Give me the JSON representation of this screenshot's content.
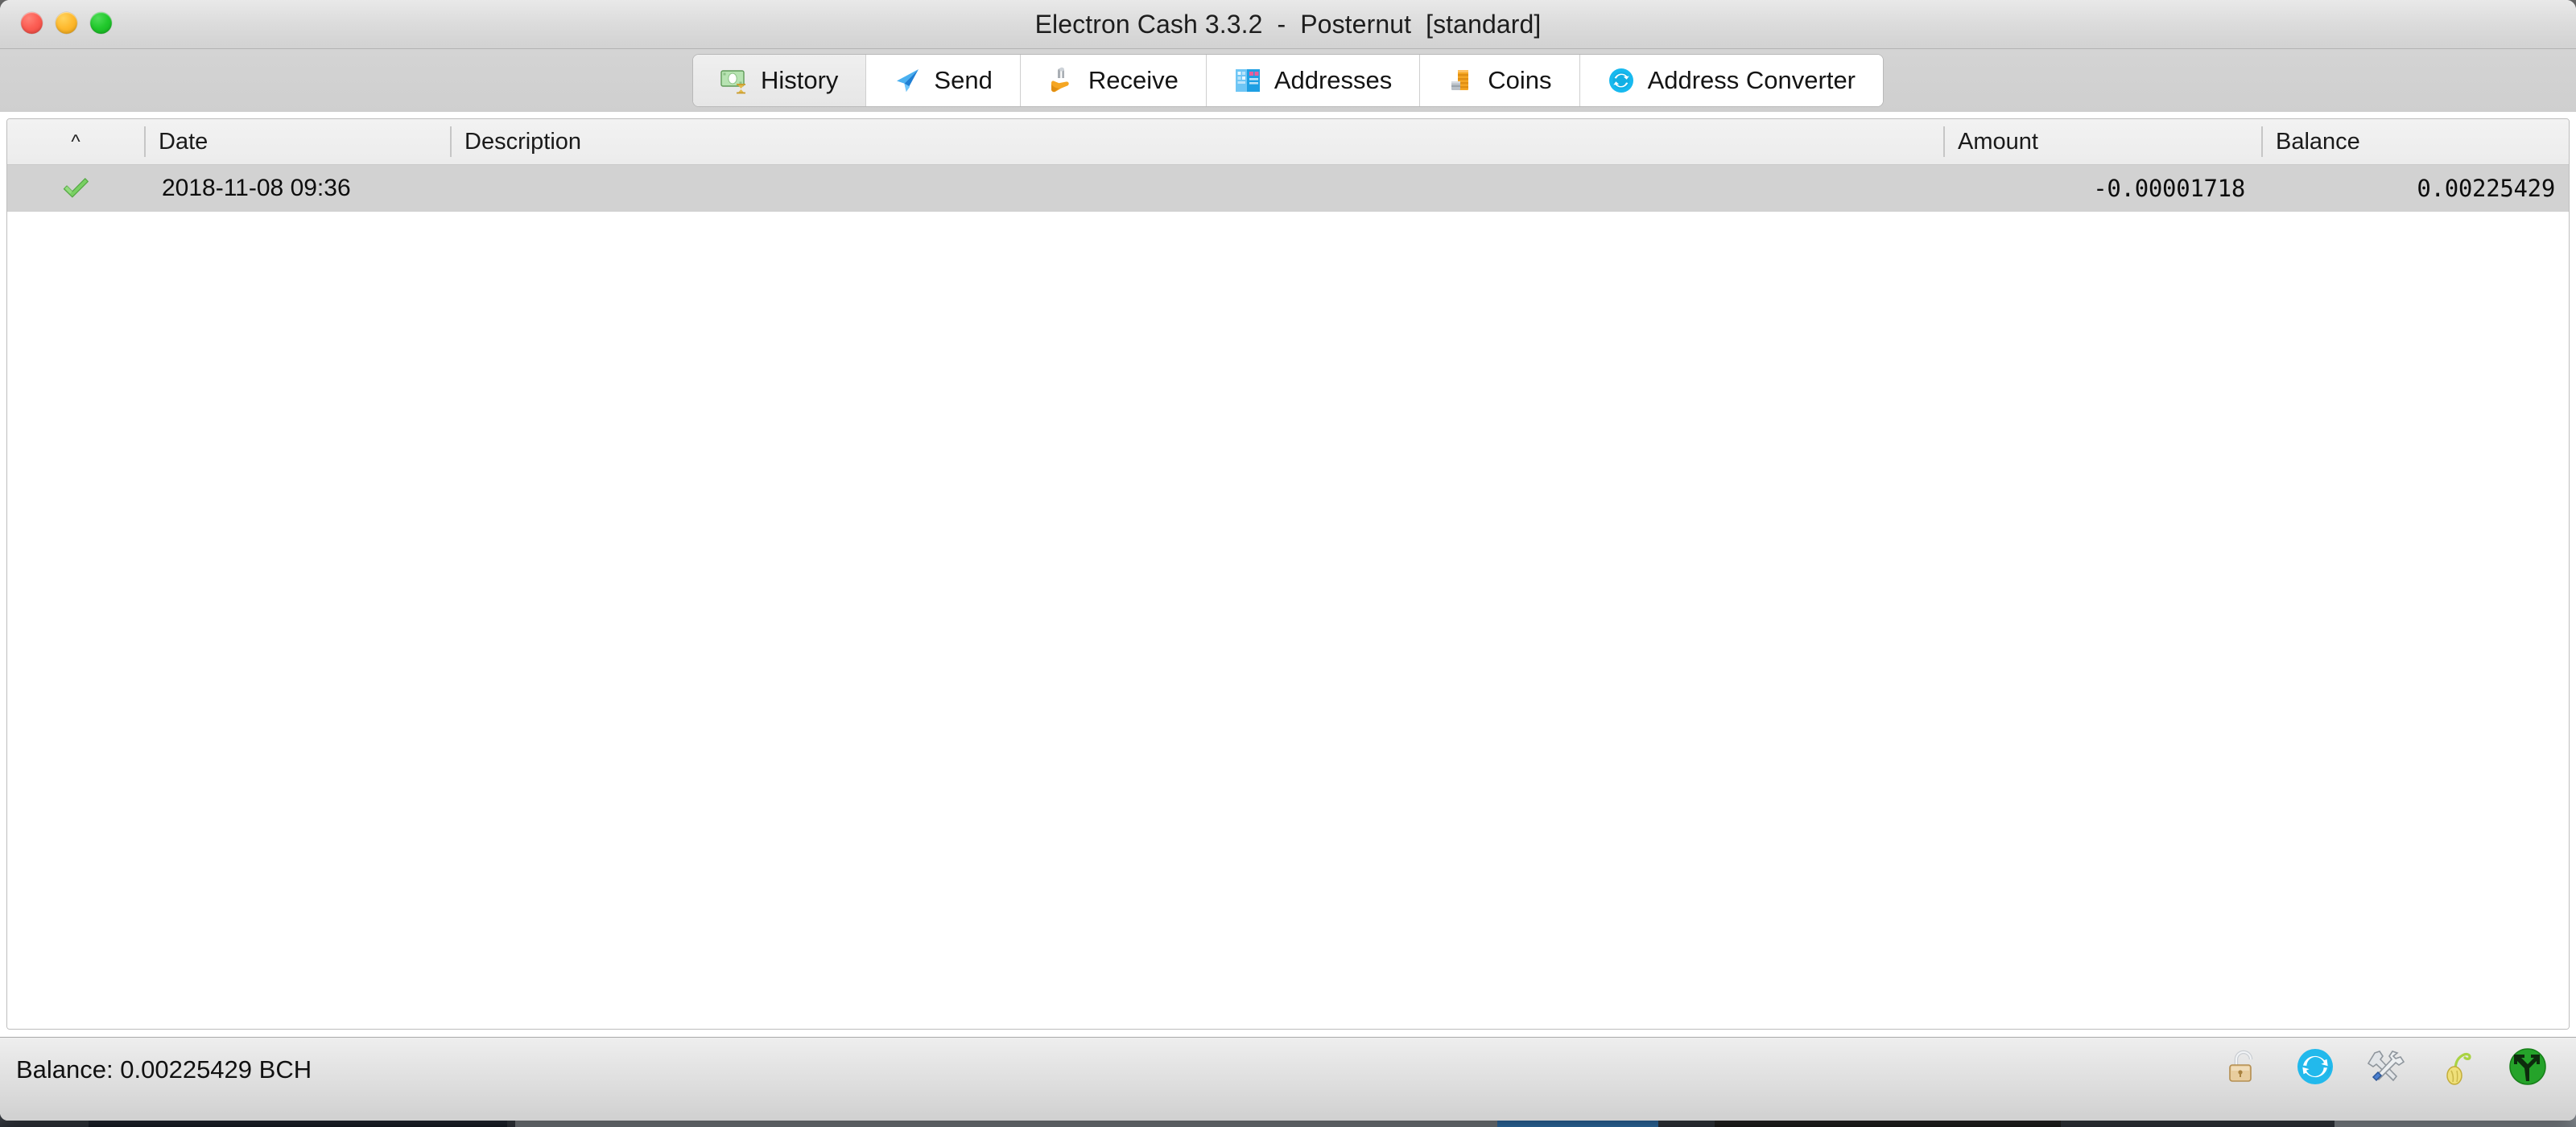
{
  "window": {
    "title": "Electron Cash 3.3.2  -  Posternut  [standard]",
    "controls": [
      {
        "name": "close",
        "color": "#fc5d53"
      },
      {
        "name": "minimize",
        "color": "#feb92e"
      },
      {
        "name": "maximize",
        "color": "#21c92c"
      }
    ]
  },
  "tabs": [
    {
      "id": "history",
      "label": "History",
      "icon": "banknote-hourglass-icon",
      "active": true
    },
    {
      "id": "send",
      "label": "Send",
      "icon": "paper-plane-icon",
      "active": false
    },
    {
      "id": "receive",
      "label": "Receive",
      "icon": "hand-coin-icon",
      "active": false
    },
    {
      "id": "addresses",
      "label": "Addresses",
      "icon": "address-book-icon",
      "active": false
    },
    {
      "id": "coins",
      "label": "Coins",
      "icon": "coin-stack-icon",
      "active": false
    },
    {
      "id": "address_converter",
      "label": "Address Converter",
      "icon": "convert-circle-icon",
      "active": false
    }
  ],
  "history_table": {
    "sort_indicator": "^",
    "columns": [
      {
        "id": "status",
        "label": ""
      },
      {
        "id": "date",
        "label": "Date"
      },
      {
        "id": "description",
        "label": "Description"
      },
      {
        "id": "amount",
        "label": "Amount"
      },
      {
        "id": "balance",
        "label": "Balance"
      }
    ],
    "rows": [
      {
        "status_icon": "confirmed-check-icon",
        "date": "2018-11-08 09:36",
        "description": "",
        "amount": "-0.00001718",
        "balance": "0.00225429",
        "selected": true
      }
    ]
  },
  "statusbar": {
    "balance_label": "Balance: 0.00225429 BCH",
    "icons": [
      {
        "id": "lock",
        "name": "padlock-open-icon",
        "color": "#d8b97e"
      },
      {
        "id": "sync",
        "name": "sync-circle-icon",
        "color": "#22b9ec"
      },
      {
        "id": "tools",
        "name": "tools-icon",
        "color": "#c9c9c9"
      },
      {
        "id": "seed",
        "name": "seed-sprout-icon",
        "color": "#e4d55e"
      },
      {
        "id": "network",
        "name": "network-fork-icon",
        "color": "#25a32a"
      }
    ]
  },
  "colors": {
    "selected_row": "#d2d2d2",
    "header_bg": "#ececec",
    "titlebar_bg": "#dcdcdc",
    "tabbar_bg": "#cfcfcf",
    "accent_cyan": "#22b9ec",
    "accent_green": "#25a32a"
  }
}
